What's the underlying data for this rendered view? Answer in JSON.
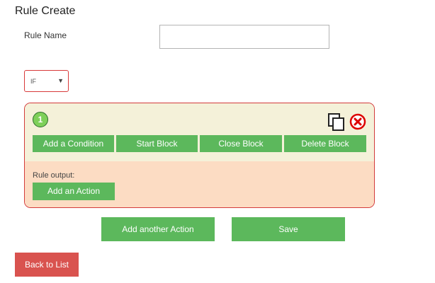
{
  "page": {
    "title": "Rule Create"
  },
  "form": {
    "rule_name_label": "Rule Name",
    "rule_name_value": "",
    "condition_select": {
      "selected": "IF"
    }
  },
  "block": {
    "number": "1",
    "icons": {
      "copy": "copy-icon",
      "delete": "delete-circle-icon"
    },
    "buttons": {
      "add_condition": "Add a Condition",
      "start_block": "Start Block",
      "close_block": "Close Block",
      "delete_block": "Delete Block"
    },
    "output_label": "Rule output:",
    "add_action": "Add an Action"
  },
  "footer": {
    "add_another_action": "Add another Action",
    "save": "Save",
    "back_to_list": "Back to List"
  },
  "colors": {
    "green": "#5cb85c",
    "red": "#d9534f",
    "block_border": "#d33b3b",
    "block_top_bg": "#f4f1d9",
    "block_bottom_bg": "#fcdcc3"
  }
}
